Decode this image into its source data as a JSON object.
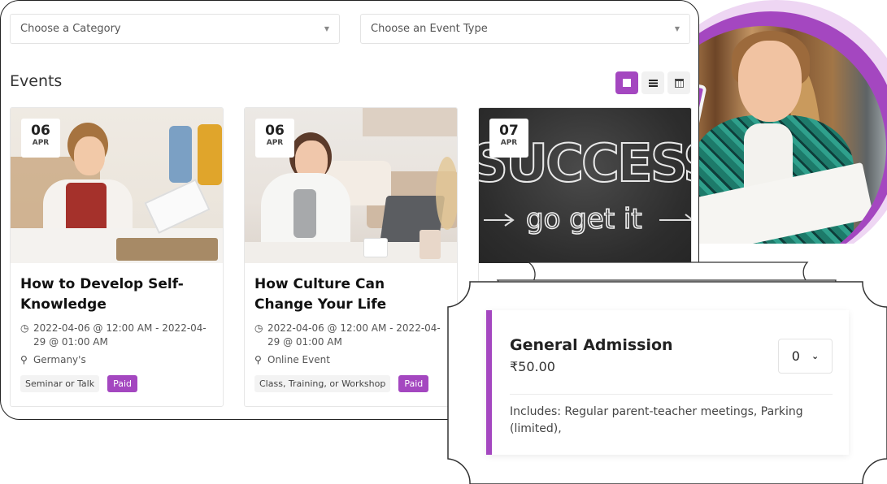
{
  "filters": {
    "category_placeholder": "Choose a Category",
    "event_type_placeholder": "Choose an Event Type"
  },
  "events": {
    "title": "Events",
    "view_modes": [
      {
        "name": "grid-view",
        "active": true
      },
      {
        "name": "list-view",
        "active": false
      },
      {
        "name": "calendar-view",
        "active": false
      }
    ],
    "cards": [
      {
        "day": "06",
        "month": "APR",
        "title": "How to Develop Self-Knowledge",
        "datetime": "2022-04-06 @ 12:00 AM - 2022-04-29 @ 01:00 AM",
        "location": "Germany's",
        "category": "Seminar or Talk",
        "price_tag": "Paid"
      },
      {
        "day": "06",
        "month": "APR",
        "title": "How Culture Can Change Your Life",
        "datetime": "2022-04-06 @ 12:00 AM - 2022-04-29 @ 01:00 AM",
        "location": "Online Event",
        "category": "Class, Training, or Workshop",
        "price_tag": "Paid"
      },
      {
        "day": "07",
        "month": "APR",
        "image_text": "SUCCESS go get it"
      }
    ]
  },
  "ticket": {
    "name": "General Admission",
    "price": "₹50.00",
    "quantity": "0",
    "includes": "Includes: Regular parent-teacher meetings, Parking (limited),"
  },
  "colors": {
    "accent": "#a447c0",
    "accent_light": "#eed6f3"
  }
}
